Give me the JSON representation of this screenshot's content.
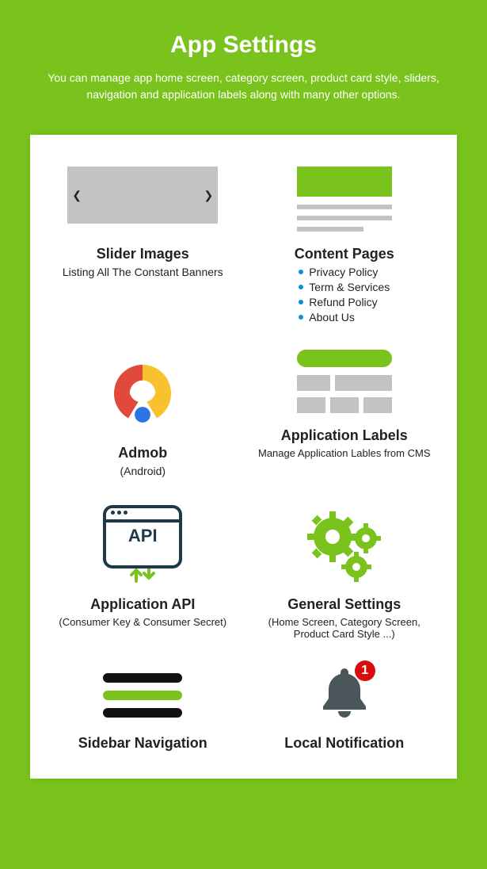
{
  "header": {
    "title": "App Settings",
    "description": "You can manage app home screen, category screen, product card style, sliders, navigation and application labels along with many other options."
  },
  "cards": {
    "slider": {
      "title": "Slider Images",
      "sub": "Listing All The Constant Banners"
    },
    "content": {
      "title": "Content Pages",
      "items": [
        "Privacy Policy",
        "Term & Services",
        "Refund Policy",
        "About Us"
      ]
    },
    "admob": {
      "title": "Admob",
      "sub": "(Android)"
    },
    "labels": {
      "title": "Application Labels",
      "sub": "Manage Application Lables from CMS"
    },
    "api": {
      "title": "Application API",
      "sub": "(Consumer Key & Consumer Secret)",
      "icon_text": "API"
    },
    "general": {
      "title": "General Settings",
      "sub": "(Home Screen, Category Screen, Product Card Style ...)"
    },
    "sidebar": {
      "title": "Sidebar Navigation"
    },
    "notification": {
      "title": "Local Notification",
      "badge": "1"
    }
  }
}
